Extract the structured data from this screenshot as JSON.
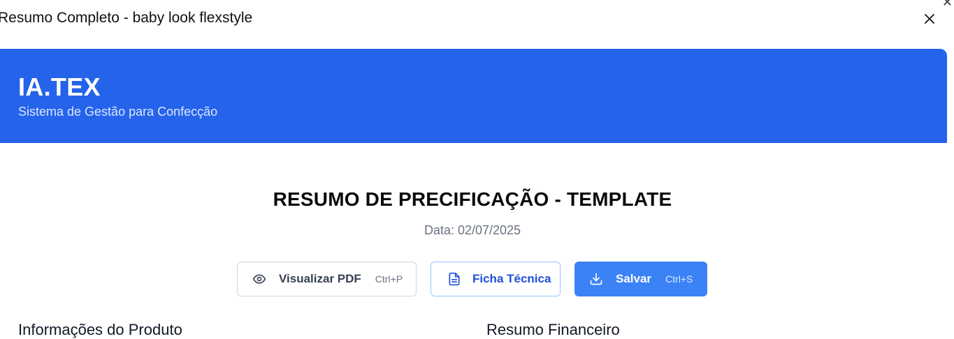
{
  "dialog": {
    "title": "Resumo Completo - baby look flexstyle",
    "close_icon": "close-icon"
  },
  "header": {
    "brand": "IA.TEX",
    "tagline": "Sistema de Gestão para Confecção",
    "color": "#2563eb"
  },
  "report": {
    "title": "RESUMO DE PRECIFICAÇÃO - TEMPLATE",
    "date": "Data: 02/07/2025"
  },
  "actions": {
    "preview_pdf": {
      "label": "Visualizar PDF",
      "shortcut": "Ctrl+P",
      "icon": "eye-icon"
    },
    "tech_sheet": {
      "label": "Ficha Técnica",
      "icon": "document-icon"
    },
    "save": {
      "label": "Salvar",
      "shortcut": "Ctrl+S",
      "icon": "download-icon",
      "color": "#3b82f6"
    }
  },
  "sections": {
    "product_info": "Informações do Produto",
    "financial_summary": "Resumo Financeiro"
  }
}
